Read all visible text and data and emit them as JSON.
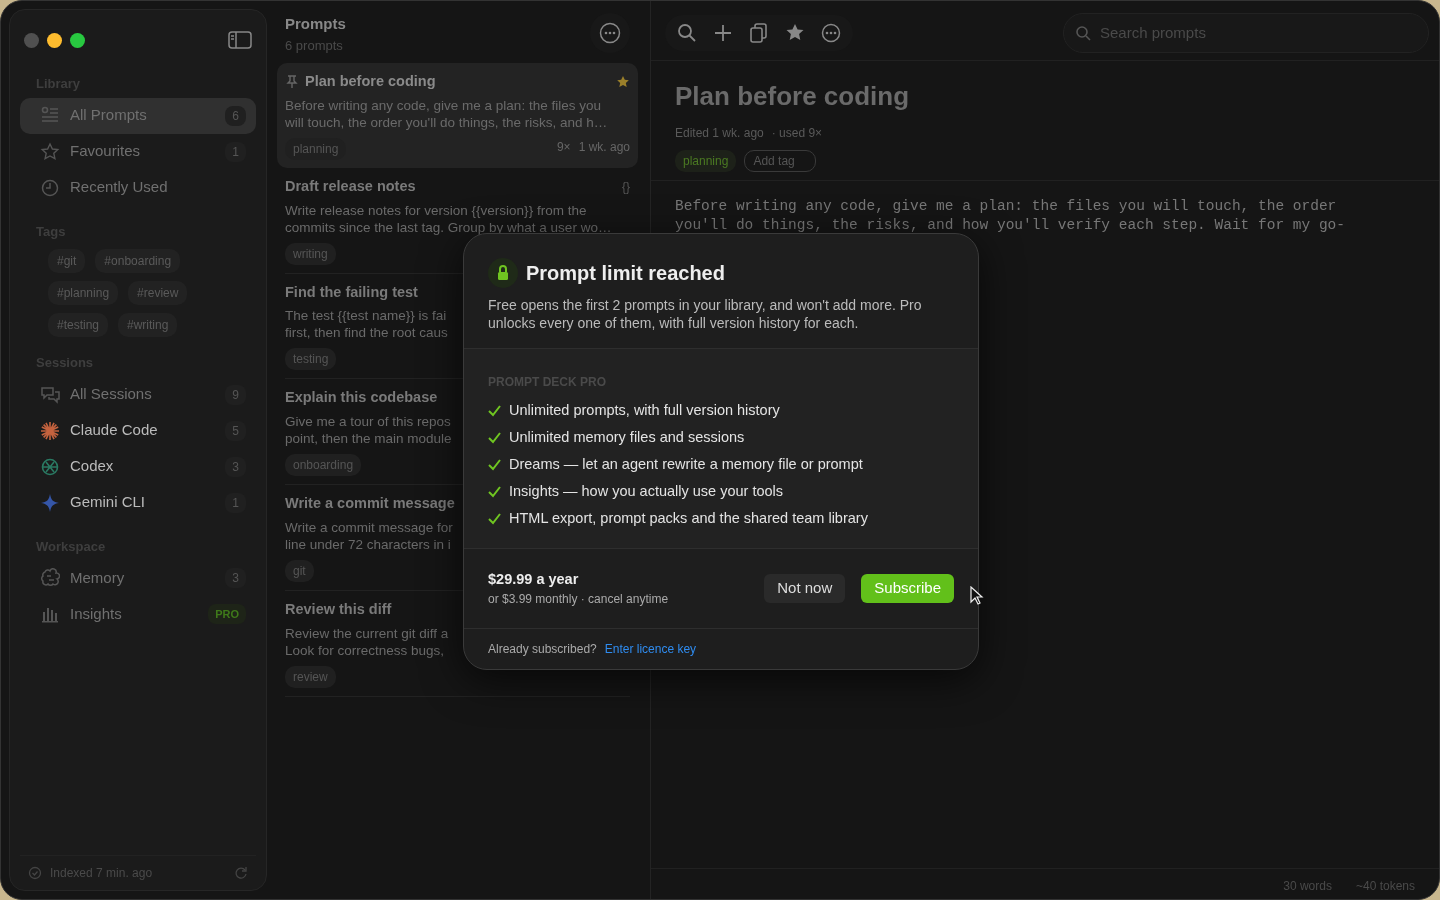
{
  "sidebar": {
    "sections": [
      {
        "title": "Library",
        "items": [
          {
            "label": "All Prompts",
            "count": "6",
            "selected": true,
            "dimmed": true
          },
          {
            "label": "Favourites",
            "count": "1",
            "selected": false,
            "dimmed": true
          },
          {
            "label": "Recently Used",
            "selected": false,
            "dimmed": true
          }
        ]
      },
      {
        "title": "Tags",
        "tags": [
          "#git",
          "#onboarding",
          "#planning",
          "#review",
          "#testing",
          "#writing"
        ]
      },
      {
        "title": "Sessions",
        "items": [
          {
            "label": "All Sessions",
            "count": "9",
            "selected": false,
            "dimmed": true
          },
          {
            "label": "Claude Code",
            "count": "5",
            "selected": false,
            "dimmed": false
          },
          {
            "label": "Codex",
            "count": "3",
            "selected": false,
            "dimmed": false
          },
          {
            "label": "Gemini CLI",
            "count": "1",
            "selected": false,
            "dimmed": false
          }
        ]
      },
      {
        "title": "Workspace",
        "items": [
          {
            "label": "Memory",
            "count": "3",
            "selected": false,
            "dimmed": true
          },
          {
            "label": "Insights",
            "pro": "PRO",
            "selected": false,
            "dimmed": true
          }
        ]
      }
    ],
    "status": "Indexed 7 min. ago"
  },
  "list": {
    "title": "Prompts",
    "subtitle": "6 prompts",
    "prompts": [
      {
        "title": "Plan before coding",
        "pinned": true,
        "starred": true,
        "selected": true,
        "description": "Before writing any code, give me a plan: the files you\nwill touch, the order you'll do things, the risks, and h…",
        "tag": "planning",
        "uses": "9×",
        "age": "1 wk. ago"
      },
      {
        "title": "Draft release notes",
        "pinned": false,
        "starred": false,
        "selected": false,
        "variables": "{}",
        "description": "Write release notes for version {{version}} from the\ncommits since the last tag. Group by what a user wo…",
        "tag": "writing"
      },
      {
        "title": "Find the failing test",
        "pinned": false,
        "selected": false,
        "description": "The test {{test name}} is fai\nfirst, then find the root caus",
        "tag": "testing"
      },
      {
        "title": "Explain this codebase",
        "pinned": false,
        "selected": false,
        "description": "Give me a tour of this repos\npoint, then the main module",
        "tag": "onboarding"
      },
      {
        "title": "Write a commit message",
        "pinned": false,
        "selected": false,
        "description": "Write a commit message for\nline under 72 characters in i",
        "tag": "git"
      },
      {
        "title": "Review this diff",
        "pinned": false,
        "selected": false,
        "description": "Review the current git diff a\nLook for correctness bugs,",
        "tag": "review"
      }
    ]
  },
  "editor": {
    "search_placeholder": "Search prompts",
    "title": "Plan before coding",
    "edited": "Edited 1 wk. ago",
    "used": "· used 9×",
    "tags": [
      "planning"
    ],
    "add_tag": "Add tag",
    "body": "Before writing any code, give me a plan: the files you will touch, the order\nyou'll do things, the risks, and how you'll verify each step. Wait for my go-",
    "words": "30 words",
    "tokens": "~40 tokens"
  },
  "modal": {
    "title": "Prompt limit reached",
    "text": "Free opens the first 2 prompts in your library, and won't add more. Pro unlocks every one of them, with full version history for each.",
    "section": "PROMPT DECK PRO",
    "features": [
      "Unlimited prompts, with full version history",
      "Unlimited memory files and sessions",
      "Dreams — let an agent rewrite a memory file or prompt",
      "Insights — how you actually use your tools",
      "HTML export, prompt packs and the shared team library"
    ],
    "price": "$29.99 a year",
    "price_note": "or $3.99 monthly · cancel anytime",
    "buttons": [
      {
        "kind": "secondary",
        "label": "Not now"
      },
      {
        "kind": "primary",
        "label": "Subscribe"
      }
    ],
    "footer": "Already subscribed?",
    "link": "Enter licence key"
  }
}
